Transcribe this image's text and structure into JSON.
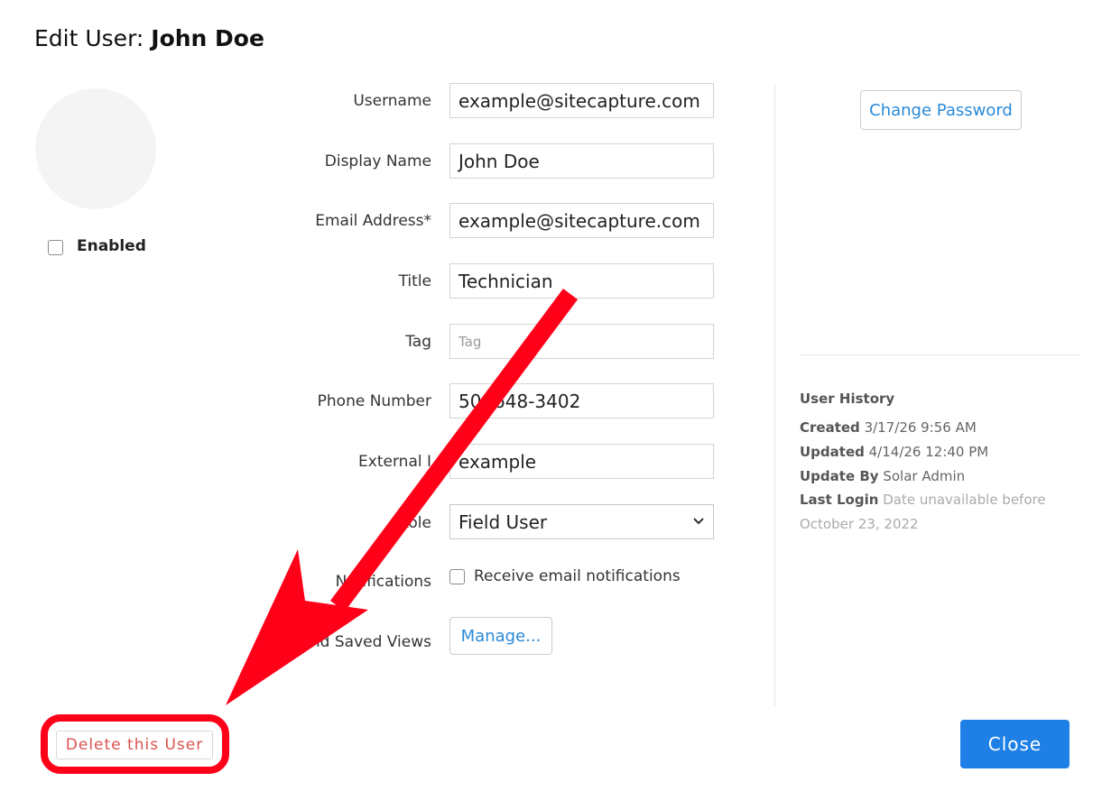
{
  "dialog": {
    "title_prefix": "Edit User:",
    "title_name": "John Doe"
  },
  "profile": {
    "enabled_label": "Enabled",
    "enabled_checked": false
  },
  "form": {
    "username": {
      "label": "Username",
      "value": "example@sitecapture.com"
    },
    "display_name": {
      "label": "Display Name",
      "value": "John Doe"
    },
    "email": {
      "label": "Email Address*",
      "value": "example@sitecapture.com"
    },
    "title": {
      "label": "Title",
      "value": "Technician"
    },
    "tag": {
      "label": "Tag",
      "placeholder": "Tag"
    },
    "phone": {
      "label": "Phone Number",
      "value": "50 -648-3402"
    },
    "external_id": {
      "label": "External I",
      "value": "example"
    },
    "role": {
      "label": "Role",
      "value": "Field User"
    },
    "notifications": {
      "label": "Notifications",
      "checkbox_label": "Receive email notifications",
      "checked": false
    },
    "saved_views": {
      "label": "nd Saved Views",
      "button_label": "Manage..."
    }
  },
  "side": {
    "change_password_label": "Change Password",
    "history": {
      "title": "User History",
      "created_label": "Created",
      "created_value": "3/17/26 9:56 AM",
      "updated_label": "Updated",
      "updated_value": "4/14/26 12:40 PM",
      "update_by_label": "Update By",
      "update_by_value": "Solar Admin",
      "last_login_label": "Last Login",
      "last_login_value": "Date unavailable before",
      "last_login_value_cont": "October 23, 2022"
    }
  },
  "footer": {
    "delete_label": "Delete this User",
    "close_label": "Close"
  },
  "colors": {
    "accent": "#1e80e6",
    "link": "#2b8ad8",
    "danger": "#d9534f",
    "annotation": "#ff0019"
  },
  "icons": {
    "role_select": "chevron-down-icon",
    "annotation": "red-arrow-icon"
  }
}
